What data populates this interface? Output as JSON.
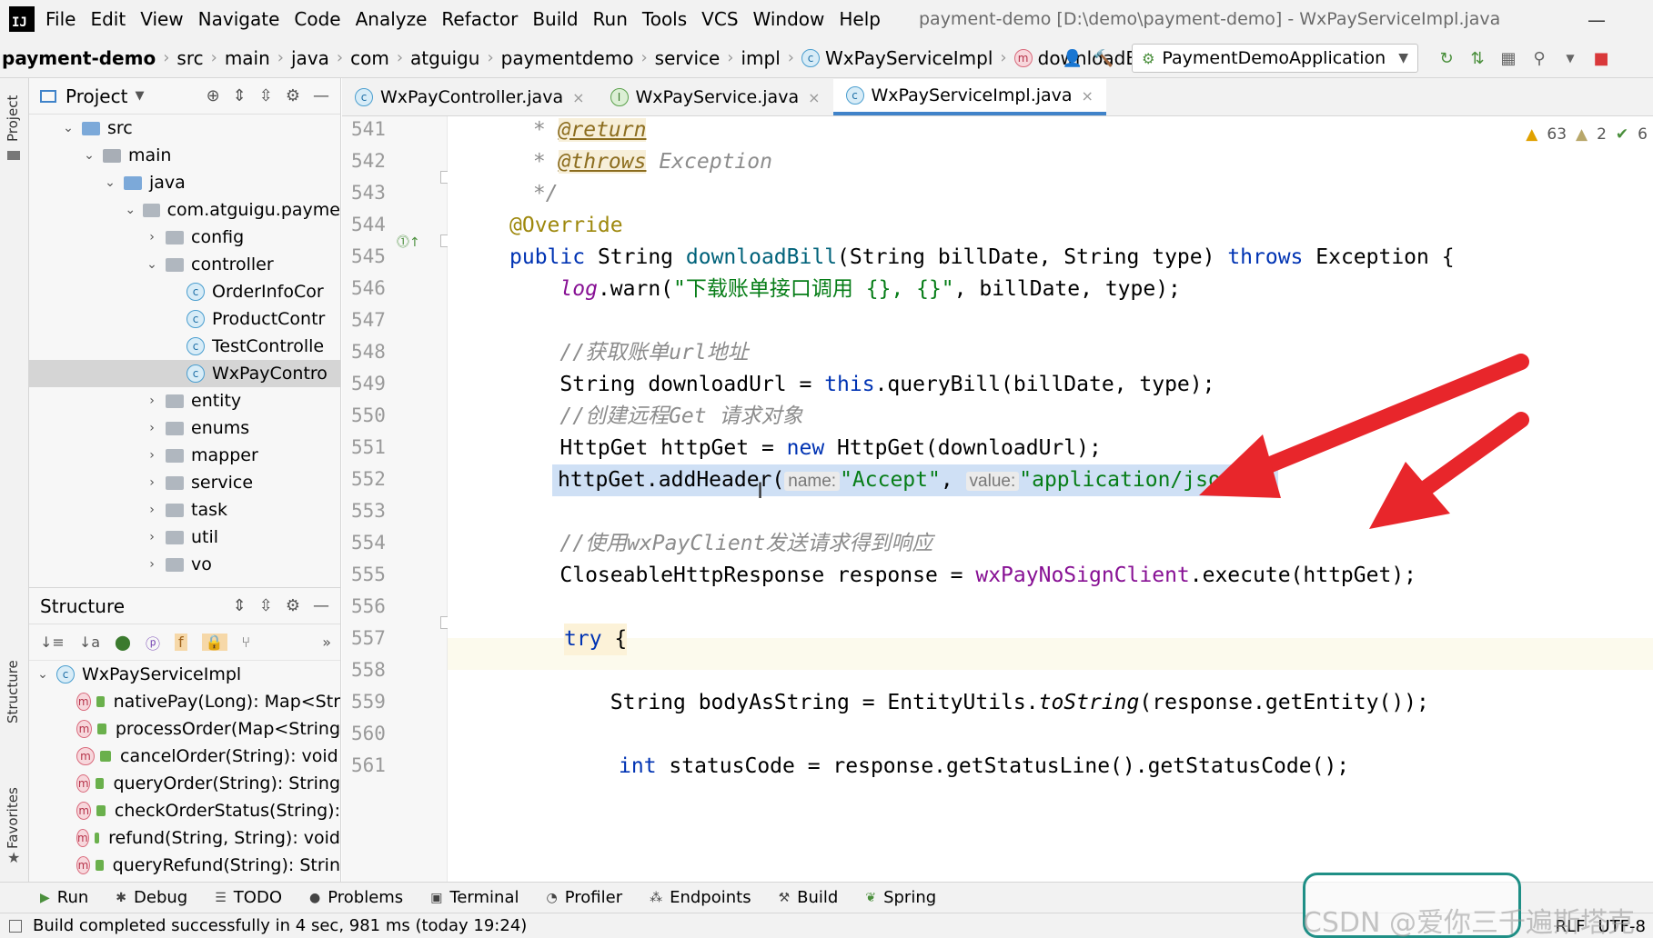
{
  "app": {
    "logo_text": "IJ",
    "window_title": "payment-demo [D:\\demo\\payment-demo] - WxPayServiceImpl.java",
    "minimize_glyph": "—"
  },
  "menu": [
    "File",
    "Edit",
    "View",
    "Navigate",
    "Code",
    "Analyze",
    "Refactor",
    "Build",
    "Run",
    "Tools",
    "VCS",
    "Window",
    "Help"
  ],
  "breadcrumbs": [
    "payment-demo",
    "src",
    "main",
    "java",
    "com",
    "atguigu",
    "paymentdemo",
    "service",
    "impl",
    "WxPayServiceImpl",
    "downloadBill"
  ],
  "run_config": "PaymentDemoApplication",
  "project_panel": {
    "title": "Project",
    "tree": [
      {
        "label": "src",
        "depth": 0,
        "arrow": "⌄",
        "kind": "src"
      },
      {
        "label": "main",
        "depth": 1,
        "arrow": "⌄",
        "kind": "folder"
      },
      {
        "label": "java",
        "depth": 2,
        "arrow": "⌄",
        "kind": "src"
      },
      {
        "label": "com.atguigu.payme",
        "depth": 3,
        "arrow": "⌄",
        "kind": "pkg"
      },
      {
        "label": "config",
        "depth": 4,
        "arrow": "›",
        "kind": "pkg"
      },
      {
        "label": "controller",
        "depth": 4,
        "arrow": "⌄",
        "kind": "pkg"
      },
      {
        "label": "OrderInfoCor",
        "depth": 5,
        "arrow": "",
        "kind": "class"
      },
      {
        "label": "ProductContr",
        "depth": 5,
        "arrow": "",
        "kind": "class"
      },
      {
        "label": "TestControlle",
        "depth": 5,
        "arrow": "",
        "kind": "class"
      },
      {
        "label": "WxPayContro",
        "depth": 5,
        "arrow": "",
        "kind": "class",
        "selected": true
      },
      {
        "label": "entity",
        "depth": 4,
        "arrow": "›",
        "kind": "pkg"
      },
      {
        "label": "enums",
        "depth": 4,
        "arrow": "›",
        "kind": "pkg"
      },
      {
        "label": "mapper",
        "depth": 4,
        "arrow": "›",
        "kind": "pkg"
      },
      {
        "label": "service",
        "depth": 4,
        "arrow": "›",
        "kind": "pkg"
      },
      {
        "label": "task",
        "depth": 4,
        "arrow": "›",
        "kind": "pkg"
      },
      {
        "label": "util",
        "depth": 4,
        "arrow": "›",
        "kind": "pkg"
      },
      {
        "label": "vo",
        "depth": 4,
        "arrow": "›",
        "kind": "pkg"
      }
    ]
  },
  "structure_panel": {
    "title": "Structure",
    "root": "WxPayServiceImpl",
    "members": [
      "nativePay(Long): Map<Str",
      "processOrder(Map<String",
      "cancelOrder(String): void",
      "queryOrder(String): String",
      "checkOrderStatus(String):",
      "refund(String, String): void",
      "queryRefund(String): Strin"
    ]
  },
  "side_labels": {
    "project": "Project",
    "structure": "Structure",
    "favorites": "Favorites"
  },
  "editor_tabs": [
    {
      "label": "WxPayController.java",
      "kind": "class"
    },
    {
      "label": "WxPayService.java",
      "kind": "interface"
    },
    {
      "label": "WxPayServiceImpl.java",
      "kind": "class",
      "active": true
    }
  ],
  "inspections": {
    "warnings": "63",
    "weak_warnings": "2",
    "ok": "6"
  },
  "code": {
    "line_numbers": [
      "541",
      "542",
      "543",
      "544",
      "545",
      "546",
      "547",
      "548",
      "549",
      "550",
      "551",
      "552",
      "553",
      "554",
      "555",
      "556",
      "557",
      "558",
      "559",
      "560",
      "561"
    ],
    "l541_star": " * ",
    "l541_tag": "@return",
    "l542_star": " * ",
    "l542_tag": "@throws",
    "l542_rest": " Exception",
    "l543": " */",
    "l544": "@Override",
    "l545_a": "public",
    "l545_b": " String ",
    "l545_fn": "downloadBill",
    "l545_c": "(String billDate, String type) ",
    "l545_kw": "throws",
    "l545_d": " Exception {",
    "l546_a": "    ",
    "l546_field": "log",
    "l546_b": ".warn(",
    "l546_str": "\"下载账单接口调用 {}, {}\"",
    "l546_c": ", billDate, type);",
    "l548": "    //获取账单url地址",
    "l549_a": "    String downloadUrl = ",
    "l549_kw": "this",
    "l549_b": ".queryBill(billDate, type);",
    "l550": "    //创建远程Get 请求对象",
    "l551_a": "    HttpGet httpGet = ",
    "l551_kw": "new",
    "l551_b": " HttpGet(downloadUrl);",
    "l552_a": "httpGet.addHeader(",
    "l552_hint1": "name:",
    "l552_str1": "\"Accept\"",
    "l552_b": ", ",
    "l552_hint2": "value:",
    "l552_str2": "\"application/json\"",
    "l552_c": ");",
    "l554": "    //使用wxPayClient发送请求得到响应",
    "l555_a": "    CloseableHttpResponse response = ",
    "l555_field": "wxPayNoSignClient",
    "l555_b": ".execute(httpGet);",
    "l557_kw": "try",
    "l557_b": " {",
    "l559_a": "        String bodyAsString = EntityUtils.",
    "l559_static": "toString",
    "l559_b": "(response.getEntity());",
    "l561_kw": "int",
    "l561_b": " statusCode = response.getStatusLine().getStatusCode();"
  },
  "bottom_tools": [
    "Run",
    "Debug",
    "TODO",
    "Problems",
    "Terminal",
    "Profiler",
    "Endpoints",
    "Build",
    "Spring"
  ],
  "status": {
    "message": "Build completed successfully in 4 sec, 981 ms (today 19:24)",
    "line_sep": "RLF",
    "encoding": "UTF-8"
  },
  "watermark": "CSDN @爱你三千遍斯塔克",
  "colors": {
    "arrow_red": "#e8262b",
    "selection": "#cfe0f5",
    "accent_tab": "#4083c9"
  }
}
